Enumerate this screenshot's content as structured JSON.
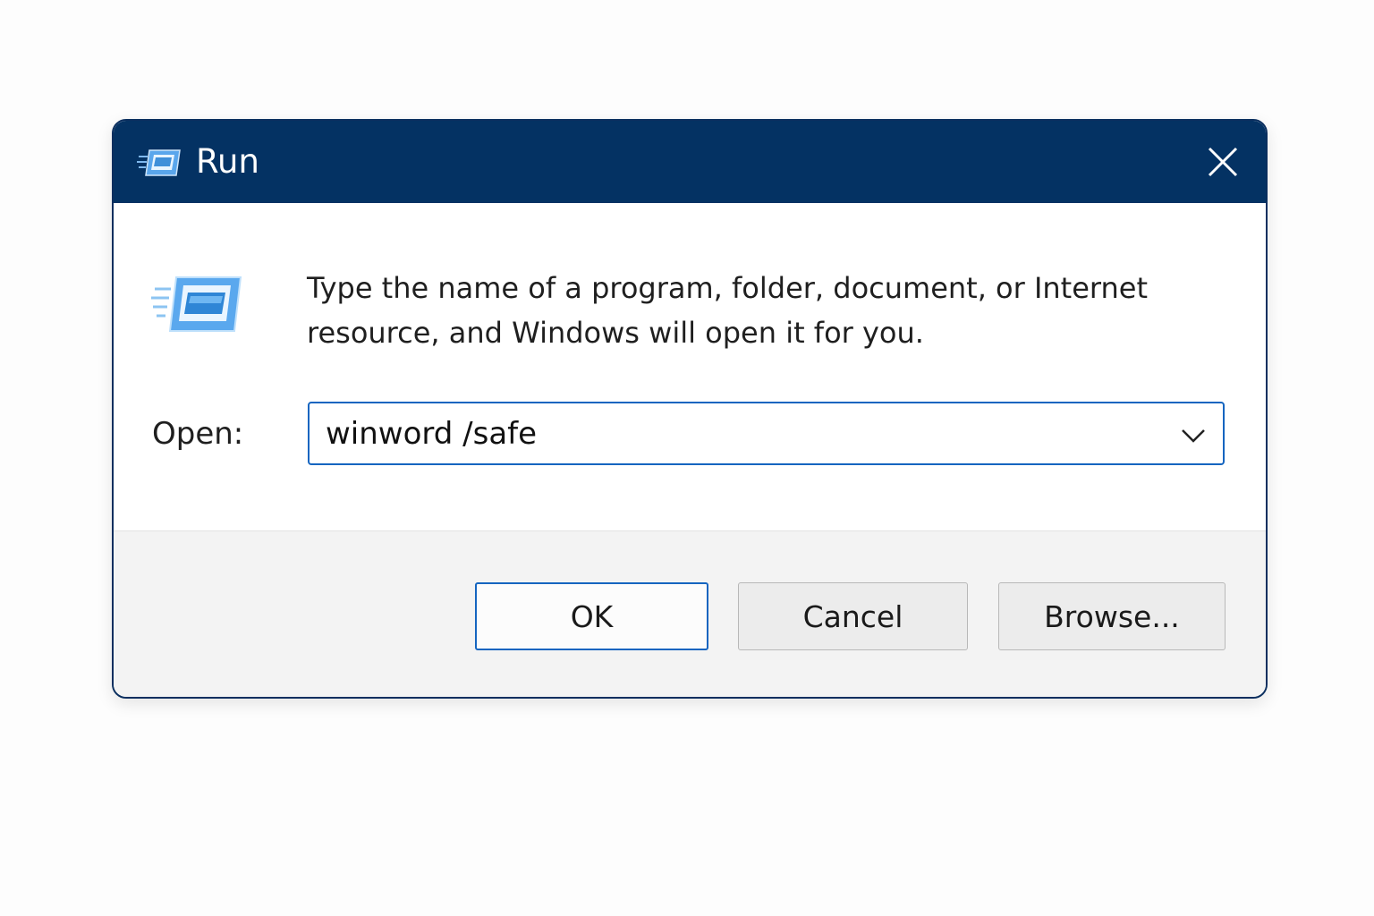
{
  "window": {
    "title": "Run",
    "icon": "run-app-icon"
  },
  "body": {
    "description": "Type the name of a program, folder, document, or Internet resource, and Windows will open it for you.",
    "icon": "run-app-icon"
  },
  "open_field": {
    "label": "Open:",
    "value": "winword /safe"
  },
  "buttons": {
    "ok": "OK",
    "cancel": "Cancel",
    "browse": "Browse..."
  },
  "colors": {
    "titlebar": "#043263",
    "accent": "#1565c0",
    "footer": "#f3f3f3"
  }
}
